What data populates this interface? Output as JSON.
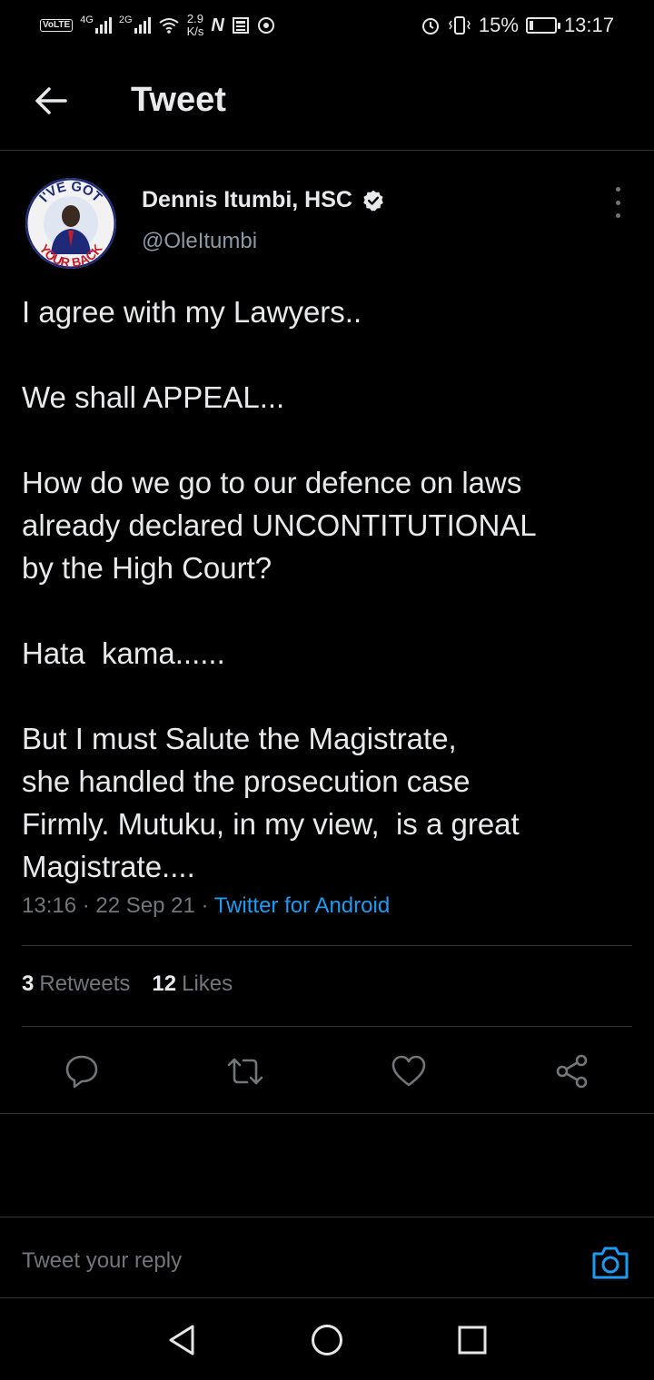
{
  "status_bar": {
    "volte": "VoLTE",
    "network_1": "4G",
    "network_2": "2G",
    "speed_value": "2.9",
    "speed_unit": "K/s",
    "battery_percent": "15%",
    "battery_level": 0.15,
    "time": "13:17"
  },
  "header": {
    "title": "Tweet",
    "back_icon": "arrow-left-icon"
  },
  "author": {
    "name": "Dennis Itumbi, HSC",
    "handle": "@OleItumbi",
    "avatar_text_top": "I'VE GOT",
    "avatar_text_bottom": "YOUR BACK",
    "verified_icon": "verified-badge-icon"
  },
  "tweet": {
    "lines": [
      "I agree with my Lawyers..",
      "",
      "We shall APPEAL...",
      "",
      "How do we go to our defence on laws",
      "already declared UNCONTITUTIONAL",
      "by the High Court?",
      "",
      "Hata  kama......",
      "",
      "But I must Salute the Magistrate,",
      "she handled the prosecution case",
      "Firmly. Mutuku, in my view,  is a great",
      "Magistrate...."
    ],
    "time": "13:16",
    "date": "22 Sep 21",
    "separator": "·",
    "source": "Twitter for Android"
  },
  "stats": {
    "retweets_count": "3",
    "retweets_label": "Retweets",
    "likes_count": "12",
    "likes_label": "Likes"
  },
  "actions": [
    "reply-icon",
    "retweet-icon",
    "like-icon",
    "share-icon"
  ],
  "reply": {
    "placeholder": "Tweet your reply",
    "camera_icon": "camera-icon"
  },
  "colors": {
    "background": "#000000",
    "accent": "#1d9bf0",
    "secondary_text": "#71767b",
    "divider": "#2f3336"
  }
}
